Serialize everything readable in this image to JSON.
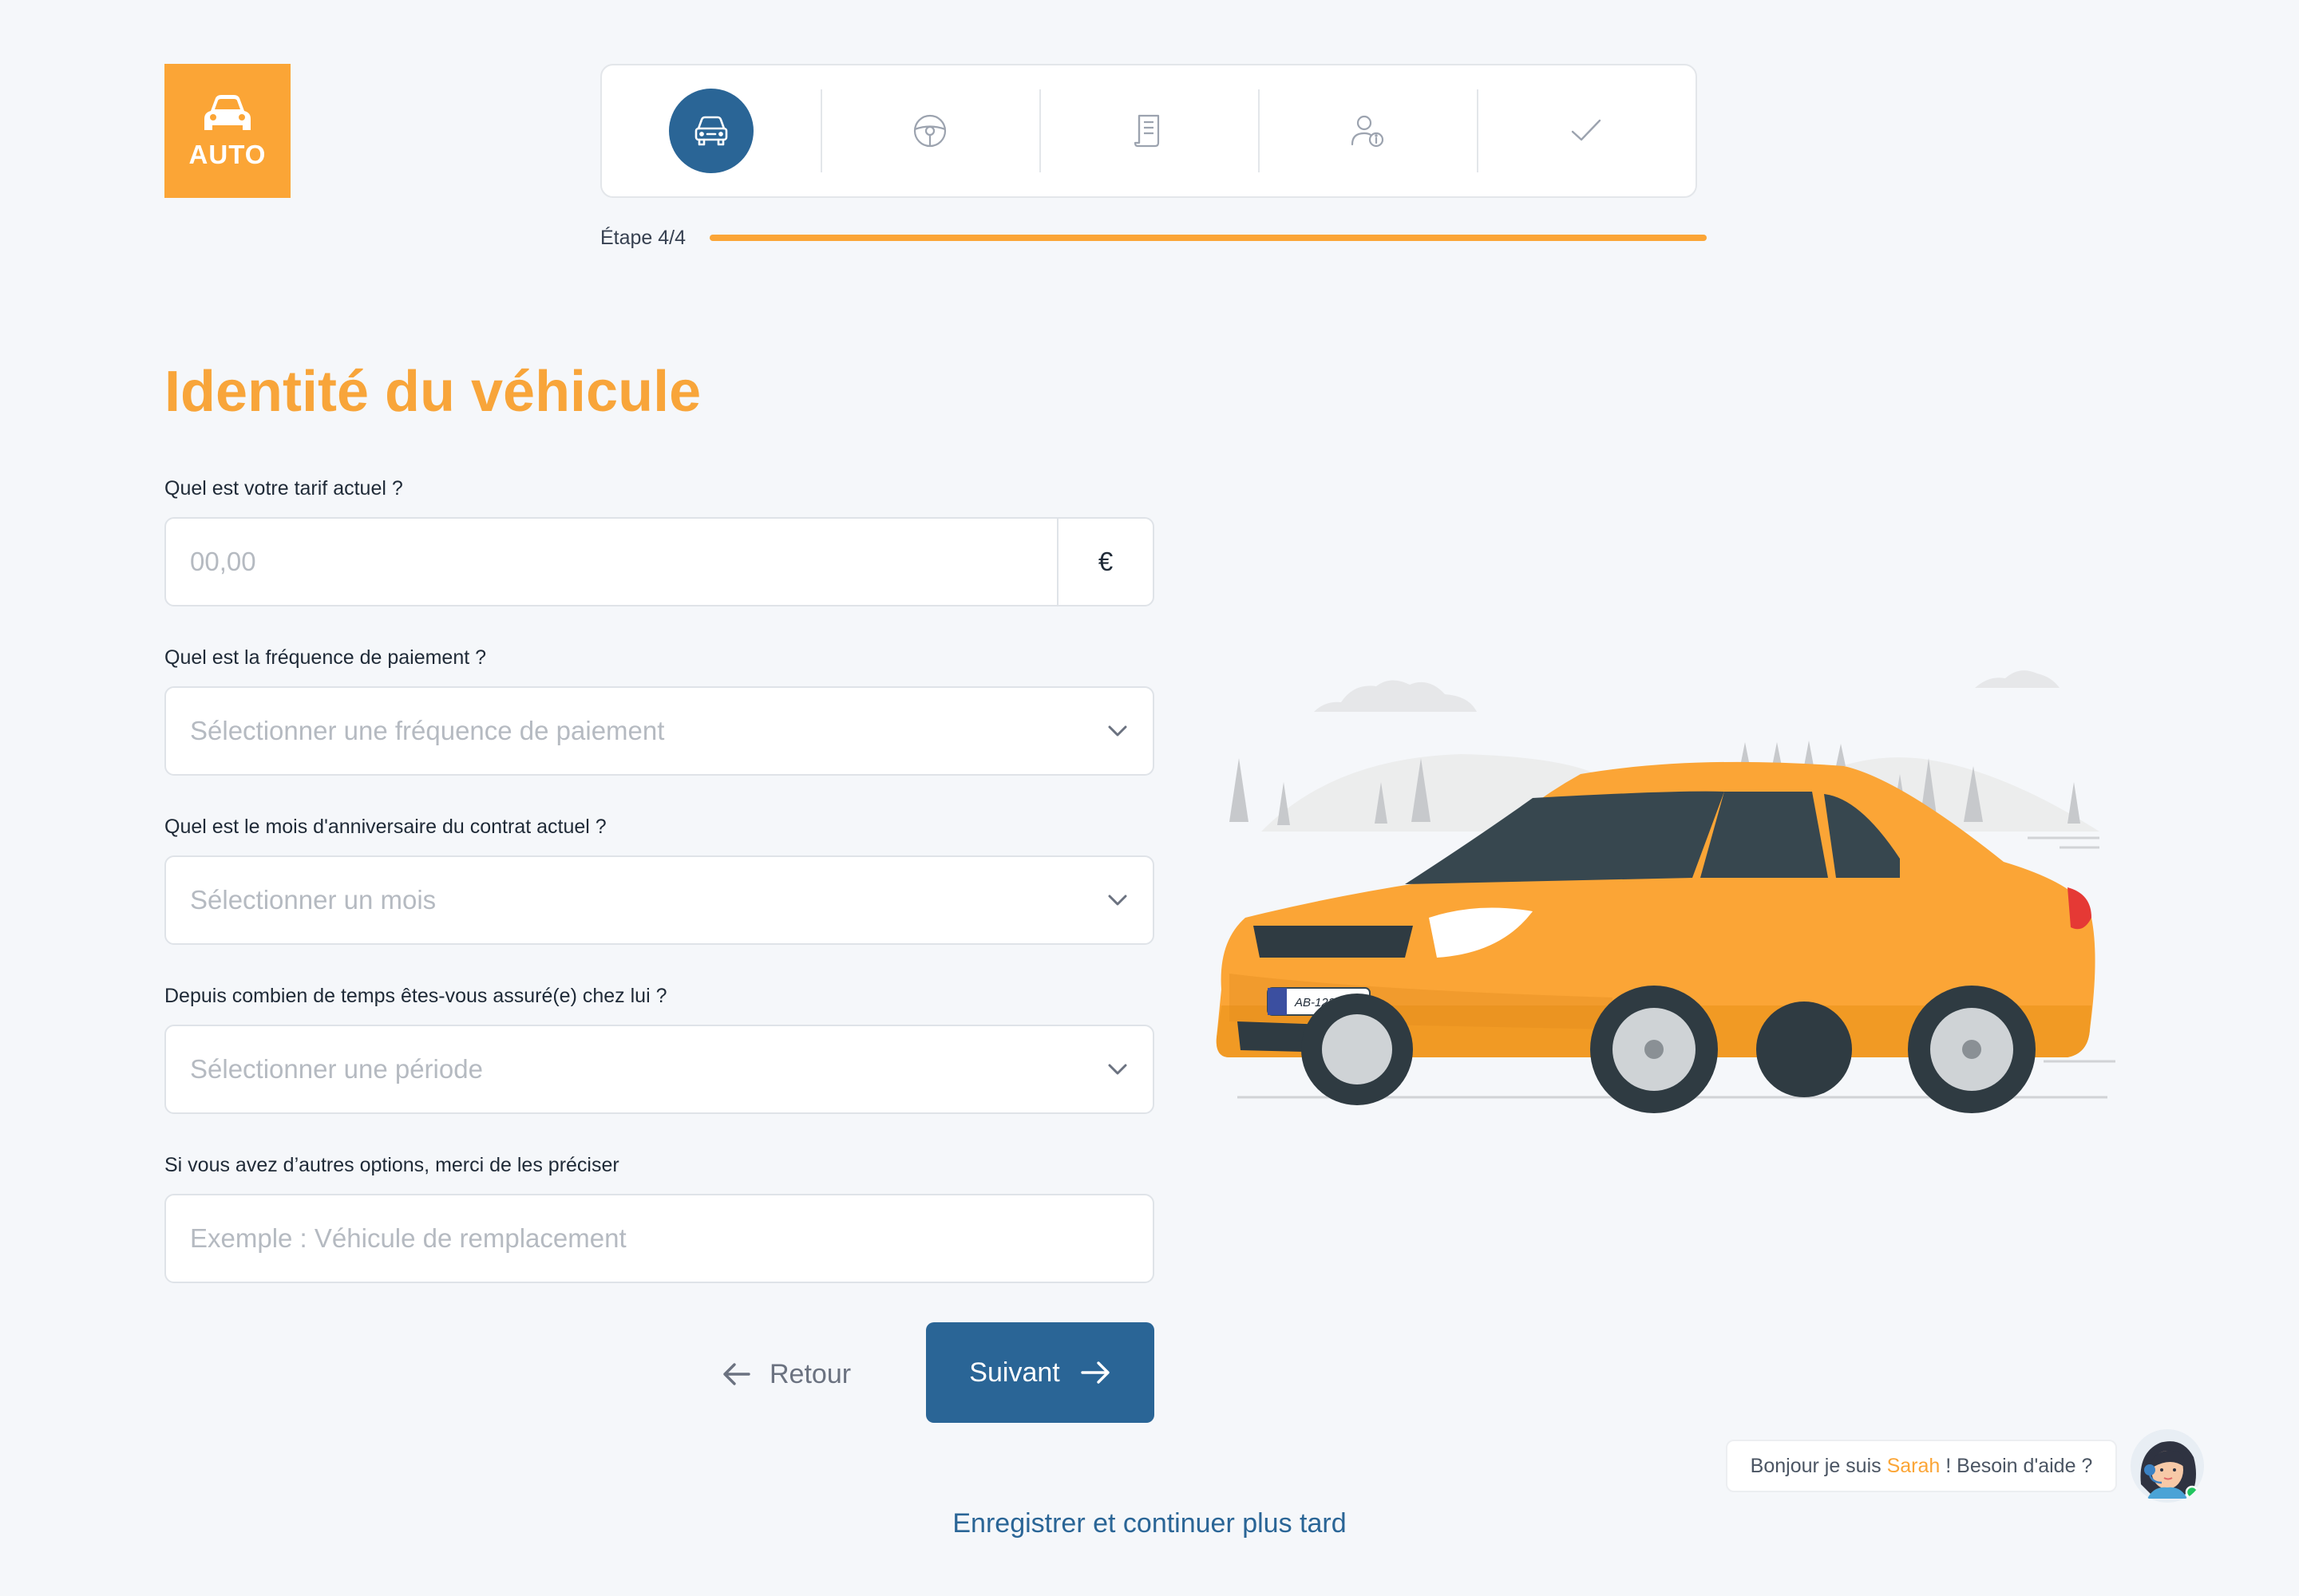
{
  "logo": {
    "text": "AUTO"
  },
  "stepper": {
    "steps": [
      {
        "icon": "car-icon",
        "active": true
      },
      {
        "icon": "steering-wheel-icon",
        "active": false
      },
      {
        "icon": "document-icon",
        "active": false
      },
      {
        "icon": "user-info-icon",
        "active": false
      },
      {
        "icon": "check-icon",
        "active": false
      }
    ],
    "step_label": "Étape 4/4",
    "progress_fraction": 1.0
  },
  "form": {
    "title": "Identité du véhicule",
    "tarif": {
      "label": "Quel est votre tarif actuel ?",
      "placeholder": "00,00",
      "currency": "€"
    },
    "frequence": {
      "label": "Quel est la fréquence de paiement ?",
      "placeholder": "Sélectionner une fréquence de paiement"
    },
    "mois": {
      "label": "Quel est le mois d'anniversaire du contrat actuel ?",
      "placeholder": "Sélectionner un mois"
    },
    "periode": {
      "label": "Depuis combien de temps êtes-vous assuré(e) chez lui ?",
      "placeholder": "Sélectionner une période"
    },
    "options": {
      "label": "Si vous avez d’autres options, merci de les préciser",
      "placeholder": "Exemple : Véhicule de remplacement"
    }
  },
  "actions": {
    "back_label": "Retour",
    "next_label": "Suivant",
    "save_later_label": "Enregistrer et continuer plus tard"
  },
  "chat": {
    "greeting_prefix": "Bonjour je suis ",
    "assistant_name": "Sarah",
    "greeting_suffix": " ! Besoin d'aide ?"
  },
  "illustration": {
    "license_plate": "AB-123-CD"
  },
  "colors": {
    "accent_orange": "#fba536",
    "primary_blue": "#2a6596",
    "background": "#f5f7fa"
  }
}
